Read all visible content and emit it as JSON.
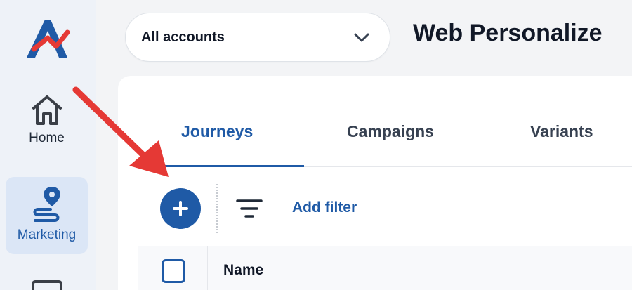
{
  "sidebar": {
    "items": [
      {
        "label": "Home",
        "icon": "home-icon"
      },
      {
        "label": "Marketing",
        "icon": "map-pin-route-icon"
      }
    ]
  },
  "header": {
    "account_select": {
      "value": "All accounts"
    },
    "title": "Web Personalize"
  },
  "main": {
    "tabs": [
      {
        "label": "Journeys",
        "active": true
      },
      {
        "label": "Campaigns",
        "active": false
      },
      {
        "label": "Variants",
        "active": false
      }
    ],
    "toolbar": {
      "add_button_icon": "plus-icon",
      "filter_icon": "filter-icon",
      "add_filter_label": "Add filter"
    },
    "table": {
      "columns": [
        "Name"
      ]
    }
  },
  "colors": {
    "accent": "#1f5aa6",
    "arrow": "#e53935",
    "logo_red": "#e53935"
  }
}
